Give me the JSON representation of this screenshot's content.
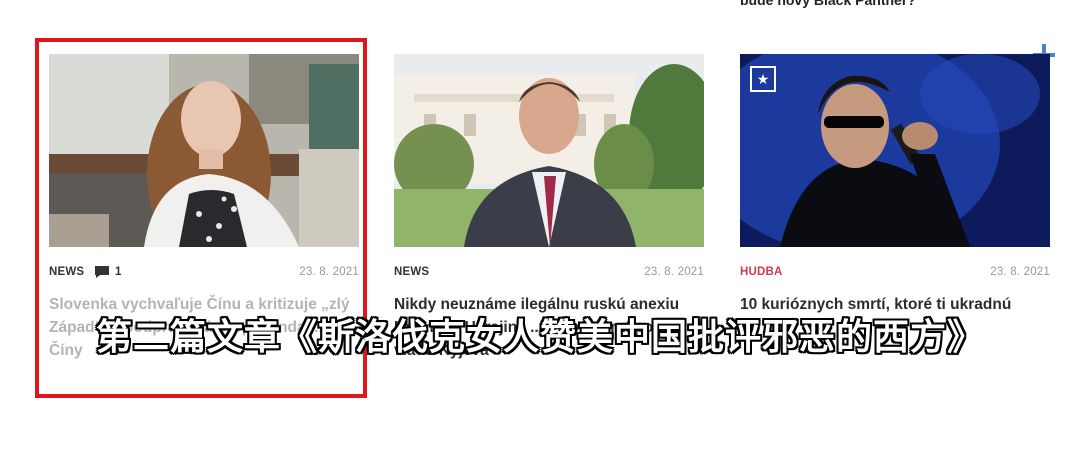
{
  "top_snippet": "bude nový Black Panther?",
  "articles": [
    {
      "category": "NEWS",
      "comment_count": "1",
      "date": "23. 8. 2021",
      "title": "Slovenka vychvaľuje Čínu a kritizuje „zlý Západ“ ... podprahová propaganda ... Číny"
    },
    {
      "category": "NEWS",
      "date": "23. 8. 2021",
      "title": "Nikdy neuznáme ilegálnu ruskú anexiu Krymu ... Ukrajina ... jeho návrat pod vládu Kyjeva"
    },
    {
      "category": "HUDBA",
      "date": "23. 8. 2021",
      "title": "10 kurióznych smrtí, ktoré ti ukradnú"
    }
  ],
  "caption": "第二篇文章《斯洛伐克女人赞美中国批评邪恶的西方》",
  "colors": {
    "highlight": "#e0161d",
    "music_category": "#d0394b",
    "plus": "#4a7fd4"
  },
  "icons": {
    "comment": "comment-icon",
    "star": "star-icon",
    "plus": "plus-icon"
  }
}
